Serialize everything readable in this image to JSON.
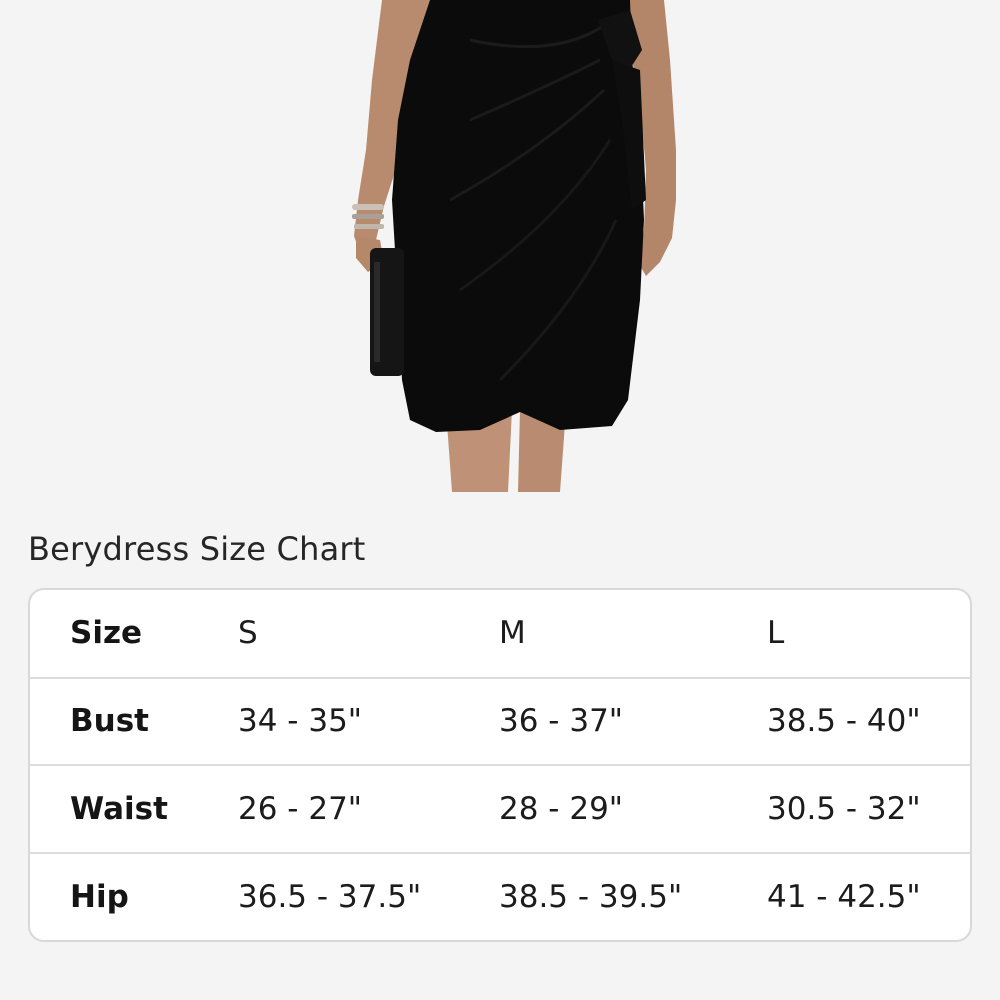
{
  "product": {
    "image_alt": "black wrap dress"
  },
  "size_chart": {
    "title": "Berydress Size Chart",
    "header": {
      "label": "Size",
      "sizes": [
        "S",
        "M",
        "L"
      ]
    },
    "rows": [
      {
        "label": "Bust",
        "values": [
          "34 - 35\"",
          "36 - 37\"",
          "38.5 - 40\""
        ]
      },
      {
        "label": "Waist",
        "values": [
          "26 - 27\"",
          "28 - 29\"",
          "30.5 - 32\""
        ]
      },
      {
        "label": "Hip",
        "values": [
          "36.5 - 37.5\"",
          "38.5 - 39.5\"",
          "41 - 42.5\""
        ]
      }
    ]
  },
  "colors": {
    "background": "#f4f4f4",
    "card_background": "#ffffff",
    "card_border": "#d8d8d8",
    "dress": "#0b0b0b",
    "skin": "#b98d72"
  }
}
